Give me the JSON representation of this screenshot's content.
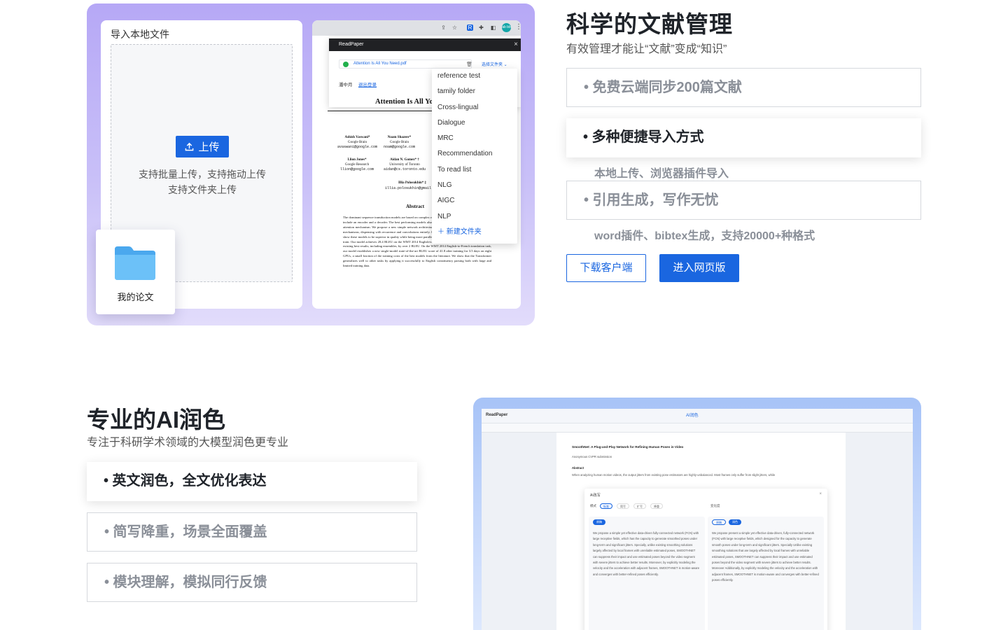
{
  "library": {
    "import_card": {
      "title": "导入本地文件",
      "upload_label": "上传",
      "hint_line1": "支持批量上传，支持拖动上传",
      "hint_line2": "支持文件夹上传"
    },
    "folder_card": {
      "label": "我的论文",
      "icon": "folder-icon"
    },
    "browser": {
      "avatar_text": "ab bb",
      "extension": {
        "name": "ReadPaper",
        "file_name": "Attention Is All You Need.pdf",
        "select_folder": "选择文件夹",
        "user": "潘中月",
        "logout": "退出登录"
      },
      "paper": {
        "title": "Attention Is All You Need",
        "authors": [
          {
            "name": "Ashish Vaswani*",
            "org": "Google Brain",
            "email": "avaswani@google.com"
          },
          {
            "name": "Noam Shazeer*",
            "org": "Google Brain",
            "email": "noam@google.com"
          },
          {
            "name": "Llion Jones*",
            "org": "Google Research",
            "email": "llion@google.com"
          },
          {
            "name": "Aidan N. Gomez* †",
            "org": "University of Toronto",
            "email": "aidan@cs.toronto.edu"
          },
          {
            "name": "Illia Polosukhin* ‡",
            "org": "",
            "email": "illia.polosukhin@gmail.com"
          }
        ],
        "abstract_heading": "Abstract",
        "abstract": "The dominant sequence transduction models are based on complex recurrent or convolutional neural networks that include an encoder and a decoder. The best performing models also connect the encoder and decoder through an attention mechanism. We propose a new simple network architecture, the Transformer, based solely on attention mechanisms, dispensing with recurrence and convolutions entirely. Experiments on two machine translation tasks show these models to be superior in quality while being more parallelizable and requiring significantly less time to train. Our model achieves 28.4 BLEU on the WMT 2014 English-to-German translation task, improving over the existing best results, including ensembles, by over 2 BLEU. On the WMT 2014 English-to-French translation task, our model establishes a new single-model state-of-the-art BLEU score of 41.8 after training for 3.5 days on eight GPUs, a small fraction of the training costs of the best models from the literature. We show that the Transformer generalizes well to other tasks by applying it successfully to English constituency parsing both with large and limited training data."
      },
      "folder_menu": [
        "reference test",
        "tamily folder",
        "Cross-lingual",
        "Dialogue",
        "MRC",
        "Recommendation",
        "To read list",
        "NLG",
        "AIGC",
        "NLP"
      ],
      "new_folder": "新建文件夹"
    },
    "title": "科学的文献管理",
    "subtitle": "有效管理才能让“文献”变成“知识”",
    "features": [
      {
        "label": "• 免费云端同步200篇文献",
        "desc": ""
      },
      {
        "label": "• 多种便捷导入方式",
        "desc": "本地上传、浏览器插件导入"
      },
      {
        "label": "• 引用生成，写作无忧",
        "desc": "word插件、bibtex生成，支持20000+种格式"
      }
    ],
    "active_feature": 1,
    "download_button": "下载客户端",
    "web_button": "进入网页版"
  },
  "polish": {
    "title": "专业的AI润色",
    "subtitle": "专注于科研学术领域的大模型润色更专业",
    "features": [
      "• 英文润色，全文优化表达",
      "• 简写降重，场景全面覆盖",
      "• 模块理解，模拟同行反馈"
    ],
    "active_feature": 0,
    "editor": {
      "logo": "ReadPaper",
      "toolbar_title": "AI润色",
      "doc_title": "SmoothNet: A Plug-and-Play Network for Refining Human Poses in Video",
      "doc_sub": "Anonymous CVPR submission",
      "abstract_label": "Abstract",
      "abstract_line": "When analyzing human motion videos, the output jitters from existing pose estimators are highly-unbalanced. Most frames only suffer from slight jitters, while",
      "modal_title": "AI改写",
      "mode_label": "模式",
      "modes": [
        "标准",
        "简写",
        "扩写",
        "降重"
      ],
      "change_label": "变化度",
      "original_tag": "原稿",
      "result_tags": [
        "原稿",
        "润色"
      ],
      "original_text": "We propose a simple yet effective data-driven fully-connected network (FCN) with large receptive fields, which has the capacity to generate smoothed poses under long-term and significant jitters. Specially, unlike existing smoothing solutions largely affected by local frames with unreliable estimated poses, SMOOTHNET can suppress their impact and use estimated poses beyond the video segment with severe jitters to achieve better results. Moreover, by explicitly modeling the velocity and the acceleration with adjacent frames, SMOOTHNET is motion-aware and converges with better-refined poses efficiently.",
      "polished_text": "We propose present a simple yet effective data-driven, fully-connected network (FCN) with large receptive fields, which designed for the capacity to generate smooth poses under long-term and significant jitters. Specially Unlike existing smoothing solutions that are largely affected by local frames with unreliable estimated poses, SMOOTHNET can suppress their impact and use estimated poses beyond the video segment with severe jitters to achieve better results. Moreover Additionally, by explicitly modeling the velocity and the acceleration with adjacent frames, SMOOTHNET is motion-aware and converges with better-refined poses efficiently."
    }
  },
  "colors": {
    "accent": "#1a66e0",
    "panel_purple": "#b6a8f6",
    "panel_blue": "#a7c3f7"
  }
}
